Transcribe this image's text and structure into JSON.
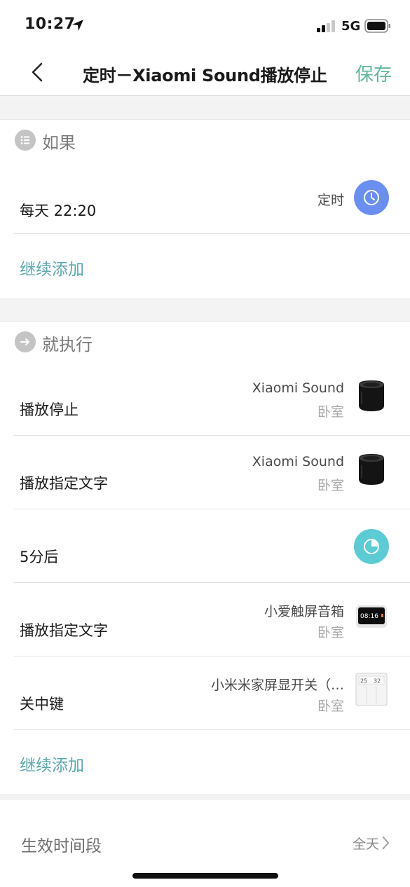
{
  "status_bar": {
    "time": "10:27",
    "network": "5G"
  },
  "nav": {
    "title": "定时－Xiaomi Sound播放停止",
    "save_label": "保存"
  },
  "if_section": {
    "label": "如果",
    "condition": {
      "label": "每天 22:20",
      "type_label": "定时"
    },
    "add_label": "继续添加"
  },
  "then_section": {
    "label": "就执行",
    "actions": [
      {
        "label": "播放停止",
        "device": "Xiaomi Sound",
        "room": "卧室",
        "icon": "speaker-icon"
      },
      {
        "label": "播放指定文字",
        "device": "Xiaomi Sound",
        "room": "卧室",
        "icon": "speaker-icon"
      },
      {
        "label": "5分后",
        "device": "",
        "room": "",
        "icon": "delay-timer-icon"
      },
      {
        "label": "播放指定文字",
        "device": "小爱触屏音箱",
        "room": "卧室",
        "icon": "touchscreen-speaker-icon",
        "screen_text": "08:16"
      },
      {
        "label": "关中键",
        "device": "小米米家屏显开关（…",
        "room": "卧室",
        "icon": "display-switch-icon",
        "screen_text_left": "25",
        "screen_text_right": "32"
      }
    ],
    "add_label": "继续添加"
  },
  "footer": {
    "label": "生效时间段",
    "value": "全天"
  },
  "colors": {
    "accent_green": "#5fb89a",
    "link_teal": "#5aa8b0",
    "timer_blue": "#6b8ff0",
    "delay_cyan": "#5ccbd4"
  }
}
